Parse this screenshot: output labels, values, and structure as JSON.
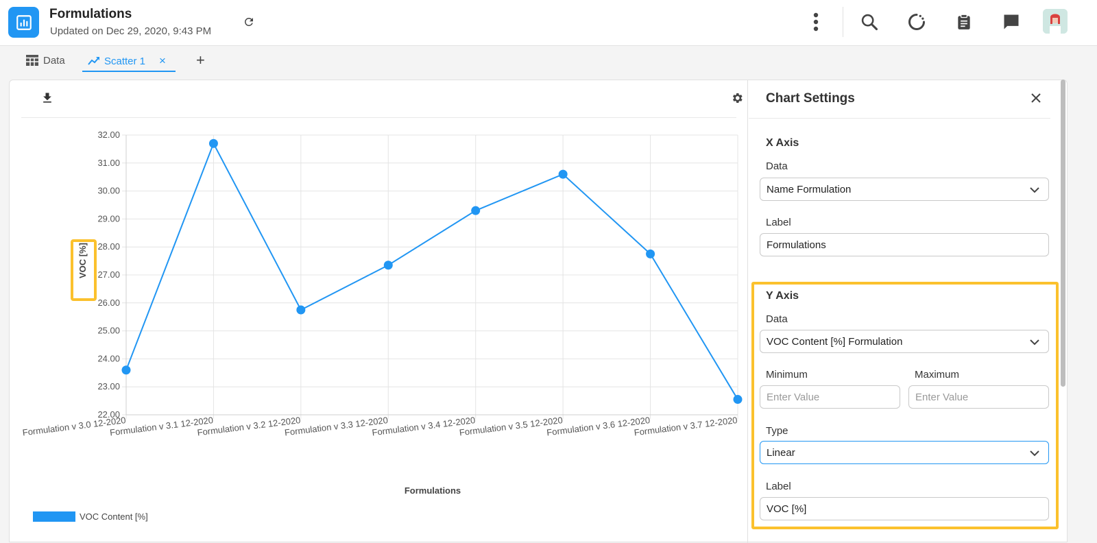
{
  "header": {
    "title": "Formulations",
    "subtitle": "Updated on Dec 29, 2020, 9:43 PM",
    "icons": [
      "refresh-icon",
      "more-vert-icon",
      "search-icon",
      "loading-icon",
      "clipboard-icon",
      "chat-icon"
    ]
  },
  "tabs": [
    {
      "label": "Data",
      "icon": "table-icon"
    },
    {
      "label": "Scatter 1",
      "icon": "trending-icon",
      "close": "×"
    }
  ],
  "add_tab": "+",
  "settings": {
    "title": "Chart Settings",
    "x_axis": {
      "title": "X Axis",
      "data_label": "Data",
      "data_value": "Name Formulation",
      "label_label": "Label",
      "label_value": "Formulations"
    },
    "y_axis": {
      "title": "Y Axis",
      "data_label": "Data",
      "data_value": "VOC Content [%] Formulation",
      "min_label": "Minimum",
      "min_placeholder": "Enter Value",
      "max_label": "Maximum",
      "max_placeholder": "Enter Value",
      "type_label": "Type",
      "type_value": "Linear",
      "label_label": "Label",
      "label_value": "VOC [%]"
    }
  },
  "colors": {
    "accent": "#2196f3",
    "highlight": "#fbc12d"
  },
  "chart_data": {
    "type": "line",
    "categories": [
      "Formulation v 3.0 12-2020",
      "Formulation v 3.1 12-2020",
      "Formulation v 3.2 12-2020",
      "Formulation v 3.3 12-2020",
      "Formulation v 3.4 12-2020",
      "Formulation v 3.5 12-2020",
      "Formulation v 3.6 12-2020",
      "Formulation v 3.7 12-2020"
    ],
    "series": [
      {
        "name": "VOC Content [%]",
        "values": [
          23.6,
          31.7,
          25.75,
          27.35,
          29.3,
          30.6,
          27.75,
          22.55
        ]
      }
    ],
    "xlabel": "Formulations",
    "ylabel": "VOC [%]",
    "ylim": [
      22,
      32
    ],
    "yticks": [
      "22.00",
      "23.00",
      "24.00",
      "25.00",
      "26.00",
      "27.00",
      "28.00",
      "29.00",
      "30.00",
      "31.00",
      "32.00"
    ],
    "grid": true,
    "legend": "bottom-left"
  }
}
